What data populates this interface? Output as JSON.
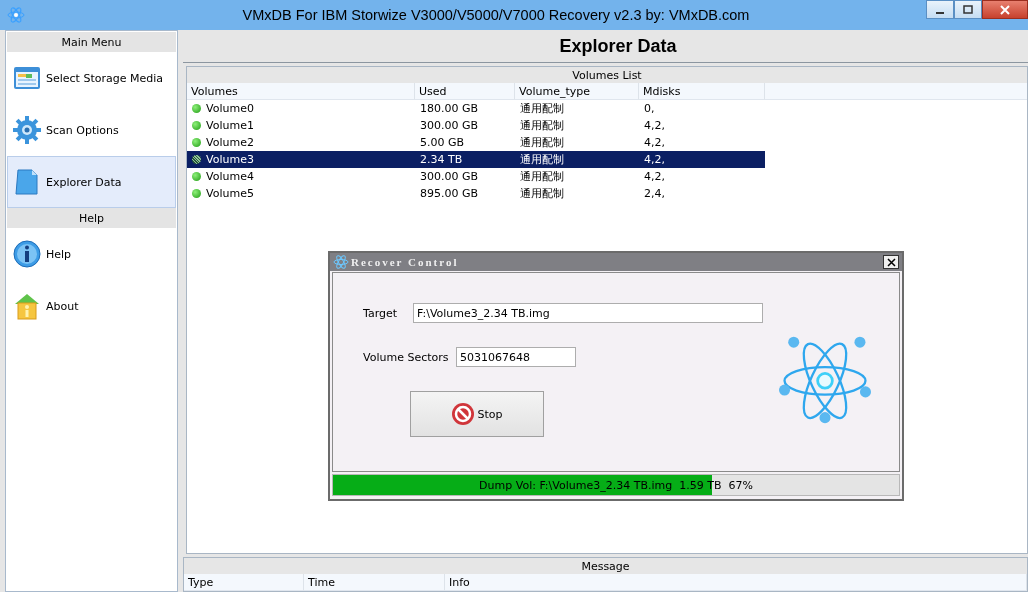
{
  "window": {
    "title": "VMxDB For IBM Storwize V3000/V5000/V7000 Recovery v2.3 by: VMxDB.com"
  },
  "sidebar": {
    "sections": [
      {
        "header": "Main Menu",
        "items": [
          {
            "label": "Select Storage Media",
            "kind": "storage",
            "selected": false
          },
          {
            "label": "Scan Options",
            "kind": "gear",
            "selected": false
          },
          {
            "label": "Explorer Data",
            "kind": "document",
            "selected": true
          }
        ]
      },
      {
        "header": "Help",
        "items": [
          {
            "label": "Help",
            "kind": "info",
            "selected": false
          },
          {
            "label": "About",
            "kind": "house",
            "selected": false
          }
        ]
      }
    ]
  },
  "page_title": "Explorer Data",
  "volumes": {
    "title": "Volumes List",
    "columns": [
      "Volumes",
      "Used",
      "Volume_type",
      "Mdisks"
    ],
    "rows": [
      {
        "cells": [
          "Volume0",
          "180.00 GB",
          "通用配制",
          "0,"
        ],
        "selected": false
      },
      {
        "cells": [
          "Volume1",
          "300.00 GB",
          "通用配制",
          "4,2,"
        ],
        "selected": false
      },
      {
        "cells": [
          "Volume2",
          "5.00 GB",
          "通用配制",
          "4,2,"
        ],
        "selected": false
      },
      {
        "cells": [
          "Volume3",
          "2.34 TB",
          "通用配制",
          "4,2,"
        ],
        "selected": true
      },
      {
        "cells": [
          "Volume4",
          "300.00 GB",
          "通用配制",
          "4,2,"
        ],
        "selected": false
      },
      {
        "cells": [
          "Volume5",
          "895.00 GB",
          "通用配制",
          "2,4,"
        ],
        "selected": false
      }
    ]
  },
  "messages": {
    "title": "Message",
    "columns": [
      "Type",
      "Time",
      "Info"
    ]
  },
  "dialog": {
    "title": "Recover Control",
    "target_label": "Target",
    "target_value": "F:\\Volume3_2.34 TB.img",
    "sectors_label": "Volume Sectors",
    "sectors_value": "5031067648",
    "button": "Stop",
    "progress": {
      "level": 0.67,
      "text": "Dump Vol: F:\\Volume3_2.34 TB.img  1.59 TB  67%"
    }
  }
}
